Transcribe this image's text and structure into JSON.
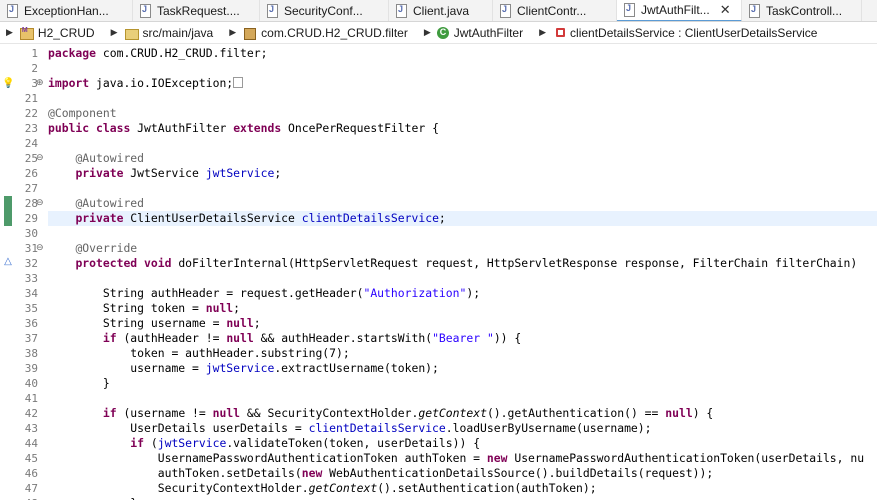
{
  "tabs": [
    {
      "label": "ExceptionHan...",
      "active": false
    },
    {
      "label": "TaskRequest....",
      "active": false
    },
    {
      "label": "SecurityConf...",
      "active": false
    },
    {
      "label": "Client.java",
      "active": false
    },
    {
      "label": "ClientContr...",
      "active": false
    },
    {
      "label": "JwtAuthFilt...",
      "active": true,
      "close": "✕"
    },
    {
      "label": "TaskControll...",
      "active": false
    }
  ],
  "breadcrumb": {
    "project": "H2_CRUD",
    "source_folder": "src/main/java",
    "package": "com.CRUD.H2_CRUD.filter",
    "class": "JwtAuthFilter",
    "member": "clientDetailsService : ClientUserDetailsService"
  },
  "editor": {
    "highlighted_line": "29",
    "lines": [
      {
        "num": "1",
        "code": "<span class=\"kw\">package</span> com.CRUD.H2_CRUD.filter;"
      },
      {
        "num": "2",
        "code": ""
      },
      {
        "num": "3",
        "fold": "⊕",
        "code": "<span class=\"kw\">import</span> java.io.IOException;<span class=\"fold-box\"></span>"
      },
      {
        "num": "21",
        "code": ""
      },
      {
        "num": "22",
        "code": "<span class=\"an\">@Component</span>"
      },
      {
        "num": "23",
        "code": "<span class=\"kw\">public</span> <span class=\"kw\">class</span> JwtAuthFilter <span class=\"kw\">extends</span> OncePerRequestFilter {"
      },
      {
        "num": "24",
        "code": ""
      },
      {
        "num": "25",
        "fold": "⊖",
        "code": "    <span class=\"an\">@Autowired</span>"
      },
      {
        "num": "26",
        "code": "    <span class=\"kw\">private</span> JwtService <span class=\"fd\">jwtService</span>;"
      },
      {
        "num": "27",
        "code": ""
      },
      {
        "num": "28",
        "fold": "⊖",
        "code": "    <span class=\"an\">@Autowired</span>"
      },
      {
        "num": "29",
        "code": "    <span class=\"kw\">private</span> ClientUserDetailsService <span class=\"fd\">clientDetailsService</span>;"
      },
      {
        "num": "30",
        "code": ""
      },
      {
        "num": "31",
        "fold": "⊖",
        "code": "    <span class=\"an\">@Override</span>"
      },
      {
        "num": "32",
        "code": "    <span class=\"kw\">protected</span> <span class=\"kw\">void</span> doFilterInternal(HttpServletRequest request, HttpServletResponse response, FilterChain filterChain)"
      },
      {
        "num": "33",
        "code": ""
      },
      {
        "num": "34",
        "code": "        String authHeader = request.getHeader(<span class=\"st\">\"Authorization\"</span>);"
      },
      {
        "num": "35",
        "code": "        String token = <span class=\"kw\">null</span>;"
      },
      {
        "num": "36",
        "code": "        String username = <span class=\"kw\">null</span>;"
      },
      {
        "num": "37",
        "code": "        <span class=\"kw\">if</span> (authHeader != <span class=\"kw\">null</span> &amp;&amp; authHeader.startsWith(<span class=\"st\">\"Bearer \"</span>)) {"
      },
      {
        "num": "38",
        "code": "            token = authHeader.substring(7);"
      },
      {
        "num": "39",
        "code": "            username = <span class=\"fd\">jwtService</span>.extractUsername(token);"
      },
      {
        "num": "40",
        "code": "        }"
      },
      {
        "num": "41",
        "code": ""
      },
      {
        "num": "42",
        "code": "        <span class=\"kw\">if</span> (username != <span class=\"kw\">null</span> &amp;&amp; SecurityContextHolder.<span class=\"it\">getContext</span>().getAuthentication() == <span class=\"kw\">null</span>) {"
      },
      {
        "num": "43",
        "code": "            UserDetails userDetails = <span class=\"fd\">clientDetailsService</span>.loadUserByUsername(username);"
      },
      {
        "num": "44",
        "code": "            <span class=\"kw\">if</span> (<span class=\"fd\">jwtService</span>.validateToken(token, userDetails)) {"
      },
      {
        "num": "45",
        "code": "                UsernamePasswordAuthenticationToken authToken = <span class=\"kw\">new</span> UsernamePasswordAuthenticationToken(userDetails, nu"
      },
      {
        "num": "46",
        "code": "                authToken.setDetails(<span class=\"kw\">new</span> WebAuthenticationDetailsSource().buildDetails(request));"
      },
      {
        "num": "47",
        "code": "                SecurityContextHolder.<span class=\"it\">getContext</span>().setAuthentication(authToken);"
      },
      {
        "num": "48",
        "code": "            }"
      }
    ]
  },
  "icons": {
    "import_warning": "lightbulb-warning-icon",
    "override_marker": "override-triangle-icon"
  }
}
